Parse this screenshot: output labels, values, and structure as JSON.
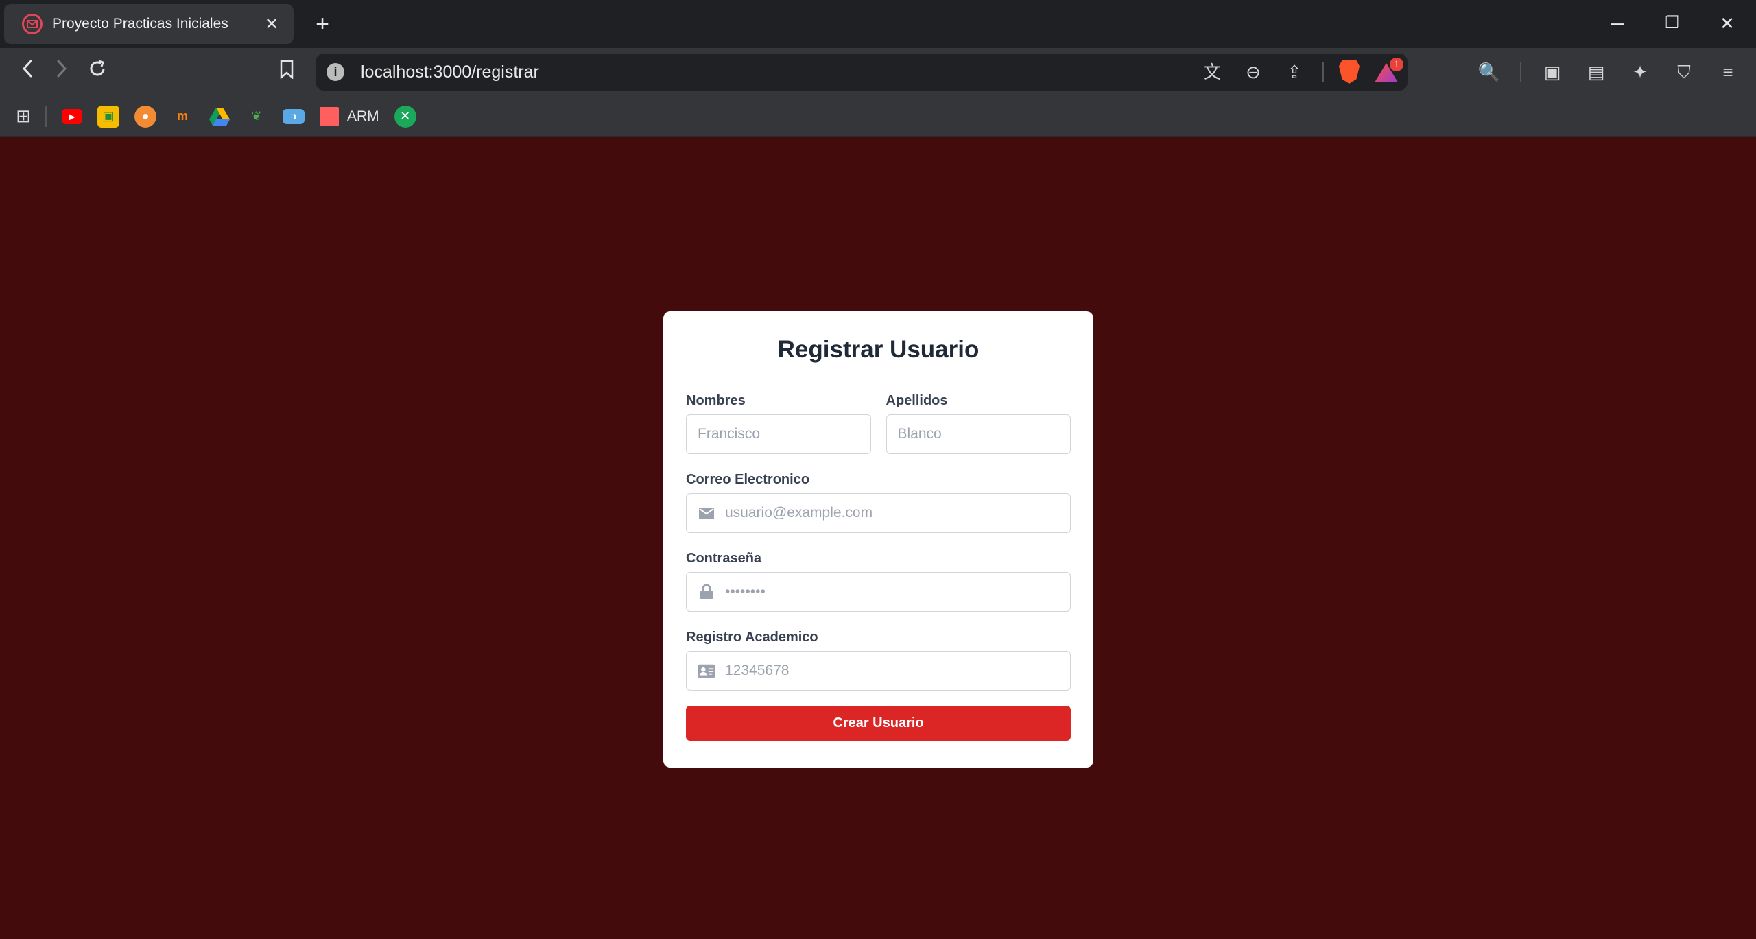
{
  "browser": {
    "tab_title": "Proyecto Practicas Iniciales",
    "tab_close": "✕",
    "new_tab": "+",
    "url": "localhost:3000/registrar",
    "extension_badge": "1",
    "bookmark_label": "ARM",
    "accent_color": "#fb542b"
  },
  "form": {
    "title": "Registrar Usuario",
    "nombres": {
      "label": "Nombres",
      "placeholder": "Francisco"
    },
    "apellidos": {
      "label": "Apellidos",
      "placeholder": "Blanco"
    },
    "correo": {
      "label": "Correo Electronico",
      "placeholder": "usuario@example.com",
      "icon": "envelope-icon"
    },
    "contrasena": {
      "label": "Contraseña",
      "placeholder": "••••••••",
      "icon": "lock-icon"
    },
    "registro": {
      "label": "Registro Academico",
      "placeholder": "12345678",
      "icon": "id-card-icon"
    },
    "submit_label": "Crear Usuario",
    "button_color": "#dc2626",
    "background_color": "#430b0b"
  }
}
